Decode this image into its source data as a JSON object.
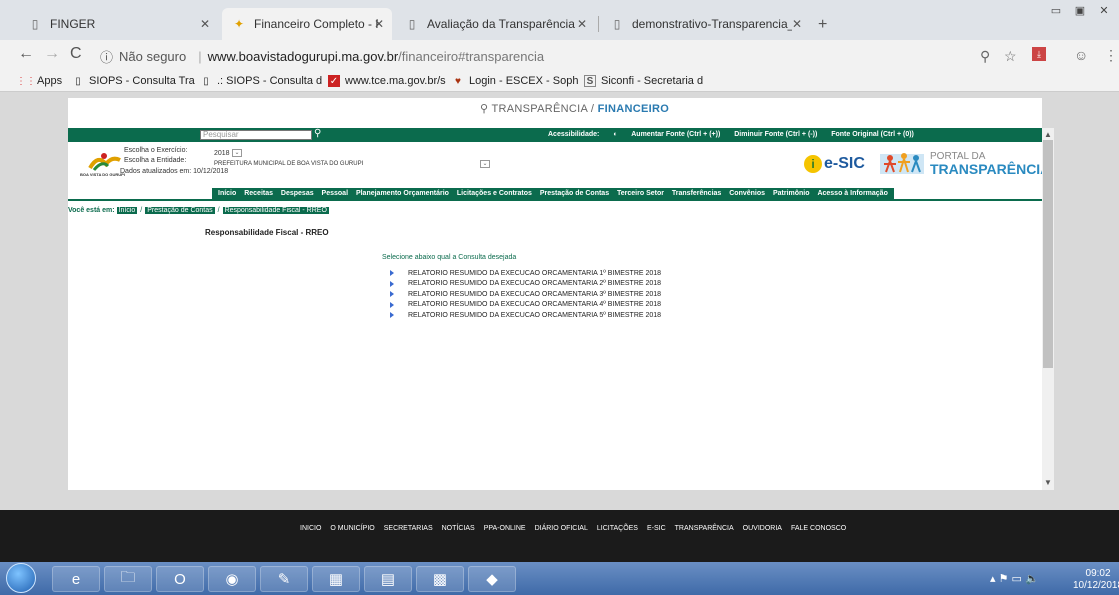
{
  "browser": {
    "tabs": [
      {
        "title": "FINGER",
        "icon": "page-icon"
      },
      {
        "title": "Financeiro Completo - Portal da",
        "icon": "site-logo-icon"
      },
      {
        "title": "Avaliação da Transparência dos",
        "icon": "page-icon"
      },
      {
        "title": "demonstrativo-Transparencia_Ex",
        "icon": "page-icon"
      }
    ],
    "address": {
      "security": "Não seguro",
      "host": "www.boavistadogurupi.ma.gov.br",
      "path": "/financeiro#transparencia"
    },
    "bookmarks": [
      {
        "label": "Apps",
        "icon": "apps-grid-icon"
      },
      {
        "label": "SIOPS - Consulta Tra",
        "icon": "page-icon"
      },
      {
        "label": ".: SIOPS - Consulta d",
        "icon": "page-icon"
      },
      {
        "label": "www.tce.ma.gov.br/s",
        "icon": "tce-icon"
      },
      {
        "label": "Login - ESCEX - Soph",
        "icon": "heart-icon"
      },
      {
        "label": "Siconfi - Secretaria d",
        "icon": "s-icon"
      }
    ]
  },
  "page": {
    "top_search": {
      "prefix": "TRANSPARÊNCIA /",
      "accent": "FINANCEIRO"
    },
    "site_search_placeholder": "Pesquisar",
    "accessibility": {
      "label": "Acessibilidade:",
      "increase": "Aumentar Fonte (Ctrl + (+))",
      "decrease": "Diminuir Fonte (Ctrl + (-))",
      "original": "Fonte Original (Ctrl + (0))"
    },
    "header": {
      "exercicio_label": "Escolha o Exercício:",
      "exercicio_value": "2018",
      "entidade_label": "Escolha a Entidade:",
      "entidade_value": "PREFEITURA MUNICIPAL DE BOA VISTA DO GURUPI",
      "updated": "Dados atualizados em: 10/12/2018",
      "logo_caption": "BOA VISTA DO GURUPI",
      "esic": "e-SIC",
      "portal_line1": "PORTAL DA",
      "portal_line2": "TRANSPARÊNCIA"
    },
    "menu": [
      "Início",
      "Receitas",
      "Despesas",
      "Pessoal",
      "Planejamento Orçamentário",
      "Licitações e Contratos",
      "Prestação de Contas",
      "Terceiro Setor",
      "Transferências",
      "Convênios",
      "Patrimônio",
      "Acesso à Informação"
    ],
    "breadcrumb": {
      "label": "Você está em:",
      "items": [
        "Início",
        "Prestação de Contas",
        "Responsabilidade Fiscal - RREO"
      ]
    },
    "title": "Responsabilidade Fiscal - RREO",
    "instruction": "Selecione abaixo qual a Consulta desejada",
    "reports": [
      "RELATORIO RESUMIDO DA EXECUCAO ORCAMENTARIA 1º BIMESTRE 2018",
      "RELATORIO RESUMIDO DA EXECUCAO ORCAMENTARIA 2º BIMESTRE 2018",
      "RELATORIO RESUMIDO DA EXECUCAO ORCAMENTARIA 3º BIMESTRE 2018",
      "RELATORIO RESUMIDO DA EXECUCAO ORCAMENTARIA 4º BIMESTRE 2018",
      "RELATORIO RESUMIDO DA EXECUCAO ORCAMENTARIA 5º BIMESTRE 2018"
    ]
  },
  "footer": {
    "links": [
      "INICIO",
      "O MUNICÍPIO",
      "SECRETARIAS",
      "NOTÍCIAS",
      "PPA-ONLINE",
      "DIÁRIO OFICIAL",
      "LICITAÇÕES",
      "E-SIC",
      "TRANSPARÊNCIA",
      "OUVIDORIA",
      "FALE CONOSCO"
    ]
  },
  "taskbar": {
    "time": "09:02",
    "date": "10/12/2018"
  },
  "colors": {
    "brand_green": "#0b6b4d",
    "accent_blue": "#2a7ab0"
  }
}
